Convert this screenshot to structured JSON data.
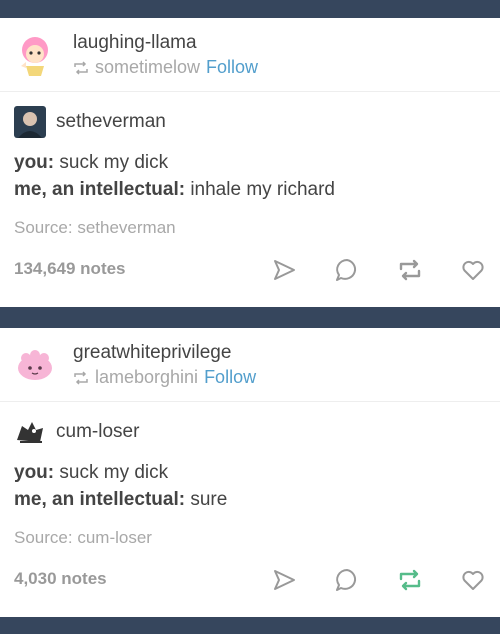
{
  "posts": [
    {
      "poster": "laughing-llama",
      "reblogged_from": "sometimelow",
      "follow_label": "Follow",
      "source_user": "setheverman",
      "lines": [
        {
          "speaker": "you:",
          "text": "suck my dick"
        },
        {
          "speaker": "me, an intellectual:",
          "text": "inhale my richard"
        }
      ],
      "source_label": "Source:",
      "source_name": "setheverman",
      "notes": "134,649 notes",
      "reblog_active": false,
      "colors": {
        "avatar": "#ff9ac6",
        "source_avatar": "#2c3e50"
      }
    },
    {
      "poster": "greatwhiteprivilege",
      "reblogged_from": "lameborghini",
      "follow_label": "Follow",
      "source_user": "cum-loser",
      "lines": [
        {
          "speaker": "you:",
          "text": "suck my dick"
        },
        {
          "speaker": "me, an intellectual:",
          "text": "sure"
        }
      ],
      "source_label": "Source:",
      "source_name": "cum-loser",
      "notes": "4,030 notes",
      "reblog_active": true,
      "colors": {
        "avatar": "#f7b5d6",
        "source_avatar": "#333333"
      }
    }
  ],
  "colors": {
    "background": "#36465d",
    "link": "#529ecc",
    "muted": "#a8a8a8",
    "reblog_active": "#56bc8a"
  }
}
